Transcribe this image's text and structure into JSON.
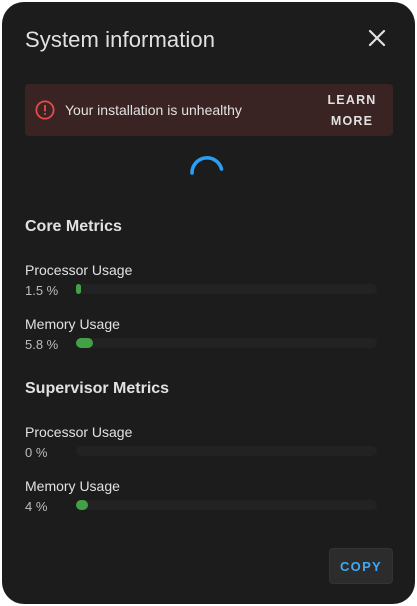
{
  "dialog": {
    "title": "System information",
    "close_icon": "close-icon"
  },
  "alert": {
    "icon": "alert-circle-icon",
    "text": "Your installation is unhealthy",
    "action_line1": "LEARN",
    "action_line2": "MORE",
    "icon_color": "#e84a4a",
    "background": "#3a2423"
  },
  "loading": {
    "icon": "spinner-icon",
    "color": "#2a9df4"
  },
  "core": {
    "heading": "Core Metrics",
    "cpu": {
      "label": "Processor Usage",
      "value": "1.5 %",
      "percent": 1.5
    },
    "memory": {
      "label": "Memory Usage",
      "value": "5.8 %",
      "percent": 5.8
    }
  },
  "supervisor": {
    "heading": "Supervisor Metrics",
    "cpu": {
      "label": "Processor Usage",
      "value": "0 %",
      "percent": 0
    },
    "memory": {
      "label": "Memory Usage",
      "value": "4 %",
      "percent": 4
    }
  },
  "footer": {
    "copy_label": "COPY"
  },
  "colors": {
    "bar_fill": "#43a047",
    "accent": "#3fa9f5"
  }
}
